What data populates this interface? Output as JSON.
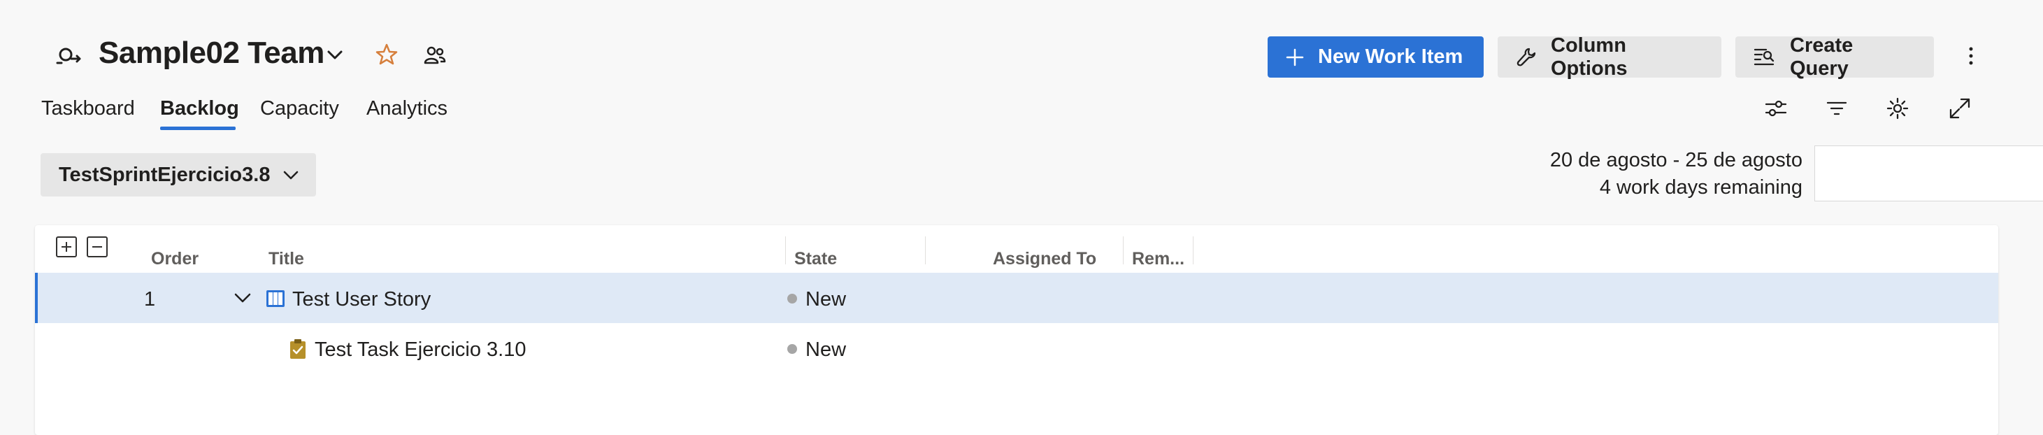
{
  "header": {
    "team_name": "Sample02 Team",
    "icons": [
      "team-icon",
      "chevron-down-icon",
      "star-icon",
      "people-icon"
    ]
  },
  "actions": {
    "new_work_item": "New Work Item",
    "column_options": "Column Options",
    "create_query": "Create Query",
    "more_icon": "more-vertical-icon"
  },
  "tabs": [
    {
      "label": "Taskboard",
      "active": false
    },
    {
      "label": "Backlog",
      "active": true
    },
    {
      "label": "Capacity",
      "active": false
    },
    {
      "label": "Analytics",
      "active": false
    }
  ],
  "toolbar_icons": [
    "settings-sliders-icon",
    "filter-icon",
    "gear-icon",
    "expand-icon"
  ],
  "sprint": {
    "name": "TestSprintEjercicio3.8",
    "dates": "20 de agosto - 25 de agosto",
    "remaining": "4 work days remaining"
  },
  "table": {
    "columns": [
      "Order",
      "Title",
      "State",
      "Assigned To",
      "Rem..."
    ],
    "rows": [
      {
        "order": "1",
        "title": "Test User Story",
        "state": "New",
        "type_icon": "user-story-icon",
        "expanded": true
      },
      {
        "order": "",
        "title": "Test Task Ejercicio 3.10",
        "state": "New",
        "type_icon": "task-icon"
      }
    ]
  },
  "colors": {
    "accent": "#2b72d5",
    "selected_row": "#dfe9f6",
    "state_new": "#a6a6a6",
    "star": "#d67f3c",
    "story_icon": "#2b72d5",
    "task_icon": "#b6902a"
  }
}
